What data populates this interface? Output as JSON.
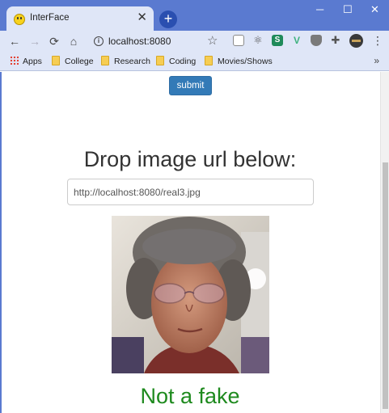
{
  "browser": {
    "tab_title": "InterFace",
    "tab_close": "✕",
    "new_tab": "+",
    "window_controls": {
      "minimize": "─",
      "maximize": "☐",
      "close": "✕"
    },
    "nav": {
      "back": "←",
      "forward": "→",
      "reload": "⟳",
      "home": "⌂"
    },
    "url": "localhost:8080",
    "bookmarks": [
      {
        "label": "Apps",
        "icon": "apps-grid-icon"
      },
      {
        "label": "College",
        "icon": "folder-icon"
      },
      {
        "label": "Research",
        "icon": "folder-icon"
      },
      {
        "label": "Coding",
        "icon": "folder-icon"
      },
      {
        "label": "Movies/Shows",
        "icon": "folder-icon"
      }
    ],
    "bookmarks_more": "»",
    "extensions": [
      "document-icon",
      "react-icon",
      "s-extension-icon",
      "v-extension-icon",
      "shield-icon",
      "puzzle-icon"
    ],
    "colors": {
      "frame": "#5a7ad0",
      "toolbar": "#dfe6f7"
    }
  },
  "page": {
    "submit_label": "submit",
    "heading": "Drop image url below:",
    "image_url_value": "http://localhost:8080/real3.jpg",
    "image_alt": "portrait photo",
    "result": "Not a fake",
    "colors": {
      "button": "#337ab7",
      "result": "#1e8a1e",
      "heading": "#333333"
    }
  }
}
